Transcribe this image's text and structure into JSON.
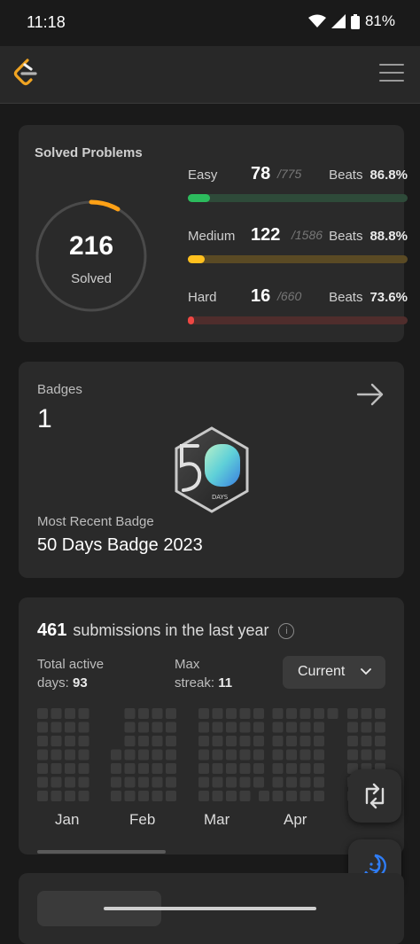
{
  "status": {
    "time": "11:18",
    "battery": "81%"
  },
  "solved": {
    "title": "Solved Problems",
    "count": "216",
    "label": "Solved",
    "rows": [
      {
        "name": "Easy",
        "solved": "78",
        "total": "/775",
        "beats_label": "Beats",
        "beats": "86.8%",
        "fraction": 0.1,
        "fill": "#2cbb5d",
        "track": "#2e4a39"
      },
      {
        "name": "Medium",
        "solved": "122",
        "total": "/1586",
        "beats_label": "Beats",
        "beats": "88.8%",
        "fraction": 0.077,
        "fill": "#ffc01e",
        "track": "#5a4a24"
      },
      {
        "name": "Hard",
        "solved": "16",
        "total": "/660",
        "beats_label": "Beats",
        "beats": "73.6%",
        "fraction": 0.024,
        "fill": "#ef4743",
        "track": "#4f2d2c"
      }
    ]
  },
  "badges": {
    "label": "Badges",
    "count": "1",
    "badge_text": "DAYS",
    "recent_label": "Most Recent Badge",
    "recent_name": "50 Days Badge 2023"
  },
  "submissions": {
    "count": "461",
    "text": "submissions in the last year",
    "active_label_1": "Total active",
    "active_label_2": "days:",
    "active_value": "93",
    "streak_label_1": "Max",
    "streak_label_2": "streak:",
    "streak_value": "11",
    "dropdown": "Current",
    "months": [
      "Jan",
      "Feb",
      "Mar",
      "Apr"
    ]
  },
  "icons": {
    "logo": "leetcode-logo-icon",
    "menu": "hamburger-menu-icon",
    "arrow": "arrow-right-icon",
    "info": "info-icon",
    "chevron": "chevron-down-icon",
    "swap": "swap-arrows-icon",
    "chat": "smiley-chat-icon"
  }
}
